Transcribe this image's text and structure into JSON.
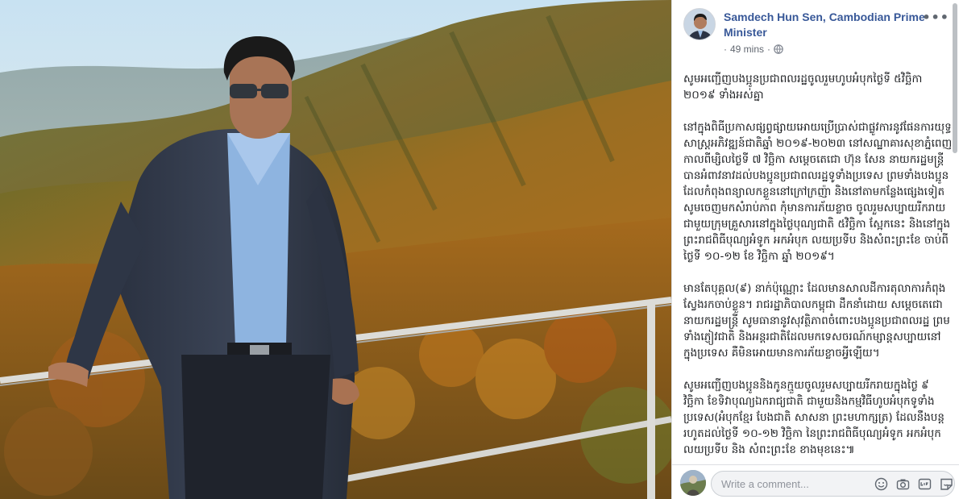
{
  "post": {
    "author": "Samdech Hun Sen, Cambodian Prime Minister",
    "time": "49 mins",
    "separator": "·",
    "more": "•••",
    "paragraphs": [
      "សូមអញ្ជើញបងប្អូនប្រជាពលរដ្ឋចូលរួមហូបអំបុកថ្ងៃទី ៥វិច្ឆិកា ២០១៩ ទាំងអស់គ្នា",
      "នៅក្នុងពិធីប្រកាសផ្សព្វផ្សាយអោយប្រើប្រាស់ជាផ្លូវការនូវផែនការយុទ្ធសាស្ត្រអភិវឌ្ឍន៍ជាតិឆ្នាំ ២០១៩-២០២៣ នៅសណ្ឋាគារសុខាភ្នំពេញ កាលពីម្សិលថ្ងៃទី ៧ វិច្ឆិកា សម្តេចតេជោ ហ៊ុន សែន នាយករដ្ឋមន្ត្រី បានអំពាវនាវដល់បងប្អូនប្រជាពលរដ្ឋទូទាំងប្រទេស ព្រមទាំងបងប្អូនដែលកំពុងពន្យាលកខ្លួននៅក្រៅក្រញ៉ា និងនៅតាមកន្លែងផ្សេងទៀត សូមចេញមកសំរាប់ភាព កុំមានការភ័យខ្លាច ចូលរួមសប្បាយរីករាយជាមួយក្រុមគ្រួសារនៅក្នុងថ្ងៃបុណ្យជាតិ ៥វិច្ឆិកា ស្អែកនេះ និងនៅក្នុងព្រះរាជពិធីបុណ្យអំទូក អកអំបុក លយប្រទីប និងសំពះព្រះខែ ចាប់ពីថ្ងៃទី ១០-១២ ខែ វិច្ឆិកា ឆ្នាំ ២០១៩។",
      "មានតែបុគ្គល(៩) នាក់ប៉ុណ្ណោះ ដែលមានសាលដីការតុលាការកំពុងស្វែងរកចាប់ខ្លួន។ រាជរដ្ឋាភិបាលកម្ពុជា ដឹកនាំដោយ សម្ដេចតេជោនាយករដ្ឋមន្ត្រី សូមធានានូវសុវត្ថិភាពចំពោះបងប្អូនប្រជាពលរដ្ឋ ព្រមទាំងភ្ញៀវជាតិ និងអន្តរជាតិដែលមកទេសចរណ៍កម្សាន្តសប្បាយនៅក្នុងប្រទេស គឺមិនអោយមានការភ័យខ្លាចអ្វីឡើយ។",
      "សូមអញ្ជើញបងប្អូននិងកូនក្មួយចូលរួមសប្បាយរីករាយក្នុងថ្ងៃ ៩ វិច្ឆិកា ខែទិវាបុណ្យឯករាជ្យជាតិ ជាមួយនិងកម្មវិធីហូបអំបុកទូទាំងប្រទេស(អំបុកខ្មែរ បែងជាតិ សាសនា ព្រះមហាក្សត្រ) ដែលនឹងបន្តរហូតដល់ថ្ងៃទី ១០-១២ វិច្ឆិកា នៃព្រះរាជពិធីបុណ្យអំទូក អកអំបុក លយប្រទីប និង សំពះព្រះខែ ខាងមុខនេះ៕"
    ]
  },
  "comment": {
    "placeholder": "Write a comment...",
    "tools": [
      "emoji-icon",
      "camera-icon",
      "gif-icon",
      "sticker-icon"
    ]
  },
  "icons": {
    "privacy": "globe-icon",
    "more": "more-options-icon"
  },
  "colors": {
    "author_link": "#385898",
    "meta_text": "#616770",
    "body_text": "#1c1e21",
    "comment_bg": "#f2f3f5"
  }
}
